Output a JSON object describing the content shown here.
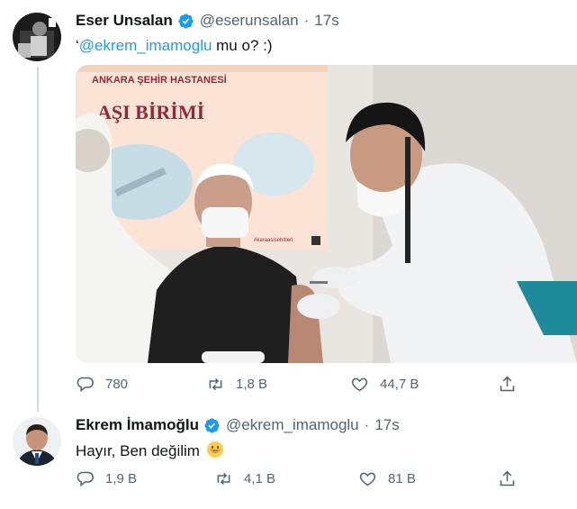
{
  "tweet1": {
    "name": "Eser Unsalan",
    "handle": "@eserunsalan",
    "separator": "·",
    "time": "17s",
    "text_prefix": "‘",
    "mention": "@ekrem_imamoglu",
    "text_suffix": " mu o? :)",
    "media": {
      "banner_hospital": "ANKARA ŞEHİR HASTANESİ",
      "banner_title": "AŞI BİRİMİ",
      "banner_hashtag": "#karaasisehitleri"
    },
    "actions": {
      "reply": "780",
      "retweet": "1,8 B",
      "like": "44,7 B"
    }
  },
  "tweet2": {
    "name": "Ekrem İmamoğlu",
    "handle": "@ekrem_imamoglu",
    "separator": "·",
    "time": "17s",
    "text": "Hayır, Ben değilim",
    "emoji": "😀",
    "actions": {
      "reply": "1,9 B",
      "retweet": "4,1 B",
      "like": "81 B"
    }
  },
  "colors": {
    "accent": "#1d9bf0",
    "muted": "#536471",
    "divider": "#cfd9de"
  },
  "icons": [
    "verified-icon",
    "reply-icon",
    "retweet-icon",
    "like-icon",
    "share-icon"
  ]
}
